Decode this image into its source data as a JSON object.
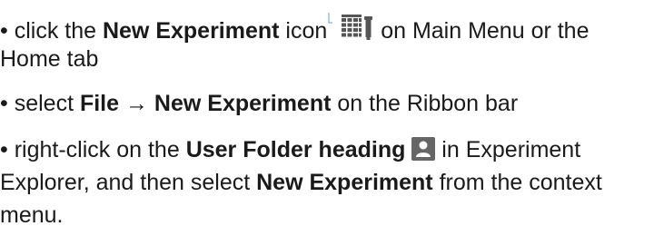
{
  "bullet": "•",
  "item1": {
    "pre": " click the ",
    "bold": "New Experiment",
    "mid": " icon",
    "post": " on Main Menu or the",
    "cont": "Home tab",
    "icon": "new-experiment-grid-icon"
  },
  "item2": {
    "pre": " select ",
    "bold": "File → New Experiment",
    "post": " on the Ribbon bar"
  },
  "item3": {
    "pre": " right-click on the ",
    "bold1": "User Folder heading",
    "post1": " in Experiment",
    "line2_pre": "Explorer, and then select ",
    "bold2": "New Experiment",
    "line2_post": " from the context",
    "line3": "menu.",
    "icon": "user-folder-icon"
  },
  "colors": {
    "text": "#1a1a1a",
    "icon_dark": "#555555",
    "icon_light": "#8a8a8a"
  }
}
